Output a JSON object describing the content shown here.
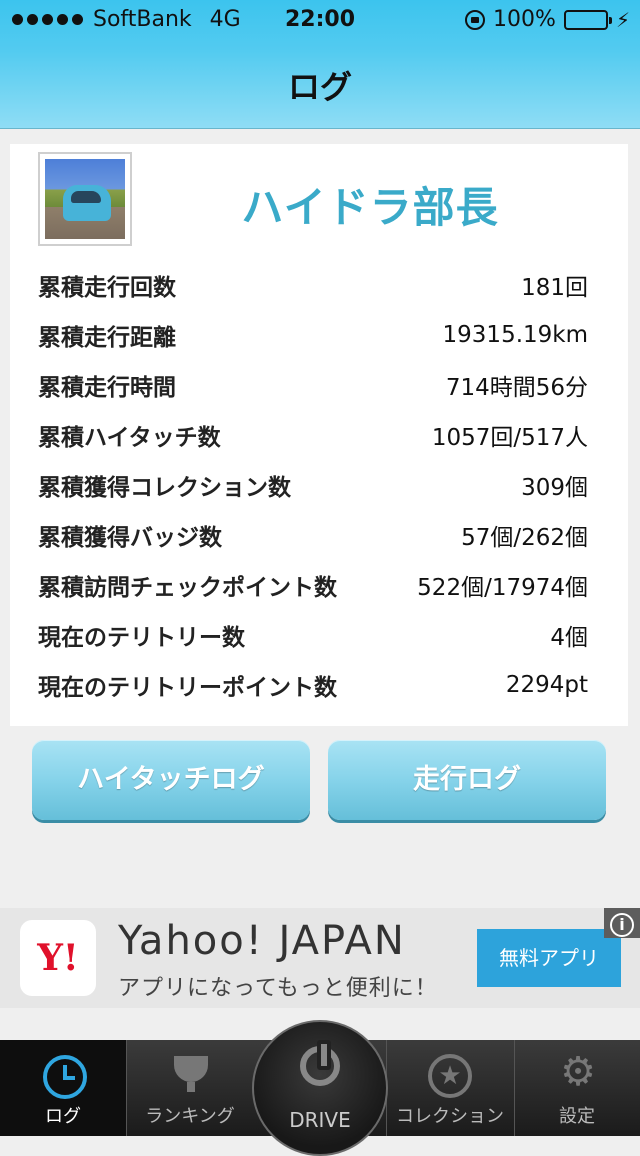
{
  "status_bar": {
    "carrier": "SoftBank",
    "network": "4G",
    "time": "22:00",
    "battery": "100%"
  },
  "header": {
    "title": "ログ"
  },
  "profile": {
    "name": "ハイドラ部長",
    "stats": [
      {
        "label": "累積走行回数",
        "value": "181回"
      },
      {
        "label": "累積走行距離",
        "value": "19315.19km"
      },
      {
        "label": "累積走行時間",
        "value": "714時間56分"
      },
      {
        "label": "累積ハイタッチ数",
        "value": "1057回/517人"
      },
      {
        "label": "累積獲得コレクション数",
        "value": "309個"
      },
      {
        "label": "累積獲得バッジ数",
        "value": "57個/262個"
      },
      {
        "label": "累積訪問チェックポイント数",
        "value": "522個/17974個"
      },
      {
        "label": "現在のテリトリー数",
        "value": "4個"
      },
      {
        "label": "現在のテリトリーポイント数",
        "value": "2294pt"
      }
    ]
  },
  "buttons": {
    "hightouch_log": "ハイタッチログ",
    "drive_log": "走行ログ"
  },
  "ad": {
    "logo": "Y!",
    "title": "Yahoo! JAPAN",
    "subtitle": "アプリになってもっと便利に！",
    "cta": "無料アプリ",
    "info_icon": "i"
  },
  "tabbar": {
    "log": "ログ",
    "ranking": "ランキング",
    "drive": "DRIVE",
    "collection": "コレクション",
    "settings": "設定",
    "active": "log"
  },
  "colors": {
    "header": "#53cbf0",
    "username": "#3aaac9",
    "button": "#86d3ea",
    "ad_cta": "#2da3db",
    "active_tab_icon": "#2fa6e0"
  }
}
